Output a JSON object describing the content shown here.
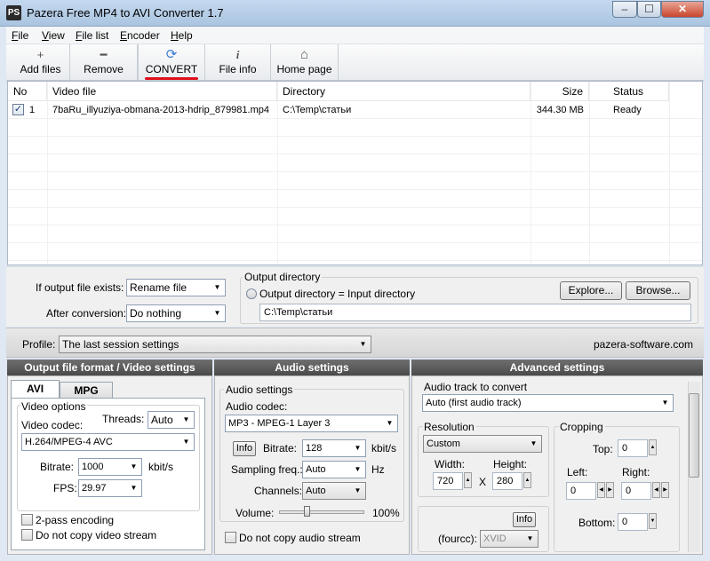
{
  "window": {
    "app_icon": "PS",
    "title": "Pazera Free MP4 to AVI Converter 1.7",
    "min_glyph": "–",
    "max_glyph": "☐",
    "close_glyph": "✕"
  },
  "menu": [
    {
      "accel": "F",
      "rest": "ile"
    },
    {
      "accel": "V",
      "rest": "iew"
    },
    {
      "accel": "F",
      "rest": "ile list"
    },
    {
      "accel": "E",
      "rest": "ncoder"
    },
    {
      "accel": "H",
      "rest": "elp"
    }
  ],
  "toolbar": {
    "add_files": {
      "icon": "plus-icon",
      "glyph": "+",
      "label": "Add files"
    },
    "remove": {
      "icon": "minus-icon",
      "glyph": "━",
      "label": "Remove"
    },
    "convert": {
      "icon": "refresh-icon",
      "glyph": "⟳",
      "label": "CONVERT"
    },
    "file_info": {
      "icon": "info-icon",
      "glyph": "i",
      "label": "File info"
    },
    "home_page": {
      "icon": "home-icon",
      "glyph": "⌂",
      "label": "Home page"
    }
  },
  "file_list": {
    "columns": [
      "No",
      "Video file",
      "Directory",
      "Size",
      "Status"
    ],
    "rows": [
      {
        "checked": true,
        "check_glyph": "✓",
        "no": "1",
        "video_file": "7baRu_illyuziya-obmana-2013-hdrip_879981.mp4",
        "directory": "C:\\Temp\\статьи",
        "size": "344.30 MB",
        "status": "Ready"
      }
    ]
  },
  "options": {
    "if_exists_label": "If output file exists:",
    "if_exists_value": "Rename file",
    "after_conversion_label": "After conversion:",
    "after_conversion_value": "Do nothing",
    "output_dir_title": "Output directory",
    "output_equals_input_label": "Output directory = Input directory",
    "output_dir_value": "C:\\Temp\\статьи",
    "explore_label": "Explore...",
    "browse_label": "Browse..."
  },
  "profile": {
    "label": "Profile:",
    "value": "The last session settings",
    "site": "pazera-software.com"
  },
  "video_panel": {
    "title": "Output file format / Video settings",
    "tabs": [
      "AVI",
      "MPG"
    ],
    "video_options_title": "Video options",
    "codec_label": "Video codec:",
    "threads_label": "Threads:",
    "threads_value": "Auto",
    "codec_value": "H.264/MPEG-4 AVC",
    "bitrate_label": "Bitrate:",
    "bitrate_value": "1000",
    "bitrate_unit": "kbit/s",
    "fps_label": "FPS:",
    "fps_value": "29.97",
    "two_pass_label": "2-pass encoding",
    "no_copy_label": "Do not copy video stream"
  },
  "audio_panel": {
    "title": "Audio settings",
    "group_title": "Audio settings",
    "codec_label": "Audio codec:",
    "codec_value": "MP3 - MPEG-1 Layer 3",
    "info_label": "Info",
    "bitrate_label": "Bitrate:",
    "bitrate_value": "128",
    "bitrate_unit": "kbit/s",
    "sampling_label": "Sampling freq.:",
    "sampling_value": "Auto",
    "sampling_unit": "Hz",
    "channels_label": "Channels:",
    "channels_value": "Auto",
    "volume_label": "Volume:",
    "volume_value": "100%",
    "no_copy_label": "Do not copy audio stream"
  },
  "advanced_panel": {
    "title": "Advanced settings",
    "track_label": "Audio track to convert",
    "track_value": "Auto (first audio track)",
    "resolution_title": "Resolution",
    "resolution_value": "Custom",
    "width_label": "Width:",
    "width_value": "720",
    "height_label": "Height:",
    "height_value": "280",
    "x_label": "X",
    "cropping_title": "Cropping",
    "top_label": "Top:",
    "top_value": "0",
    "left_label": "Left:",
    "left_value": "0",
    "right_label": "Right:",
    "right_value": "0",
    "bottom_label": "Bottom:",
    "bottom_value": "0",
    "info_label": "Info",
    "fourcc_label": "(fourcc):",
    "fourcc_value": "XVID"
  },
  "glyphs": {
    "dropdown": "▼",
    "spin_up": "▲",
    "spin_down": "▼",
    "spin_left": "◀",
    "spin_right": "▶"
  },
  "colors": {
    "convert_underline": "#e0101a",
    "panel_header": "#5a5a5a",
    "close_button": "#c9462c"
  }
}
